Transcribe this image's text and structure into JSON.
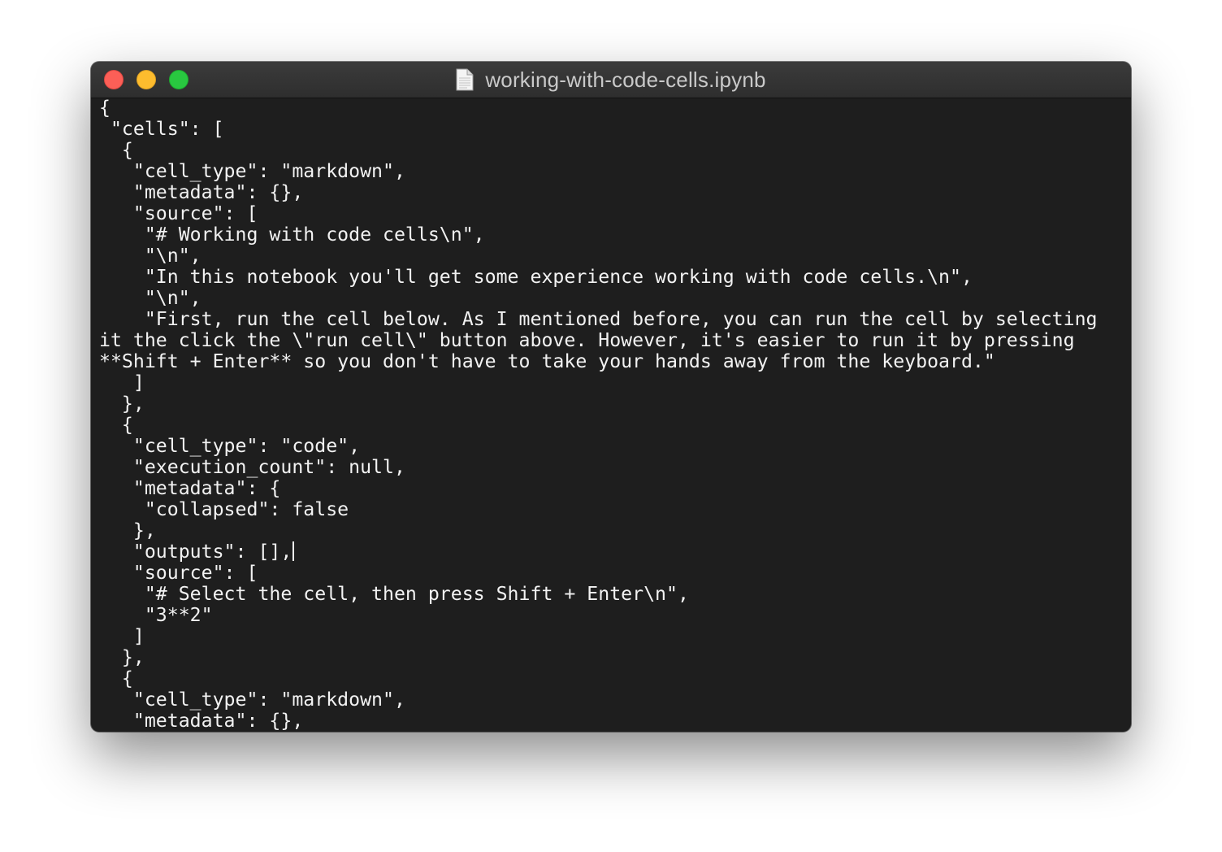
{
  "window": {
    "title": "working-with-code-cells.ipynb",
    "file_icon": "document-icon",
    "buttons": {
      "close_color": "#fc5f57",
      "minimize_color": "#fdbc2e",
      "maximize_color": "#29c840"
    }
  },
  "editor": {
    "background_color": "#1e1e1e",
    "text_color": "#f2f2f2",
    "cursor_line": 21,
    "lines": [
      "{",
      " \"cells\": [",
      "  {",
      "   \"cell_type\": \"markdown\",",
      "   \"metadata\": {},",
      "   \"source\": [",
      "    \"# Working with code cells\\n\",",
      "    \"\\n\",",
      "    \"In this notebook you'll get some experience working with code cells.\\n\",",
      "    \"\\n\",",
      "    \"First, run the cell below. As I mentioned before, you can run the cell by selecting",
      "it the click the \\\"run cell\\\" button above. However, it's easier to run it by pressing",
      "**Shift + Enter** so you don't have to take your hands away from the keyboard.\"",
      "   ]",
      "  },",
      "  {",
      "   \"cell_type\": \"code\",",
      "   \"execution_count\": null,",
      "   \"metadata\": {",
      "    \"collapsed\": false",
      "   },",
      "   \"outputs\": [],",
      "   \"source\": [",
      "    \"# Select the cell, then press Shift + Enter\\n\",",
      "    \"3**2\"",
      "   ]",
      "  },",
      "  {",
      "   \"cell_type\": \"markdown\",",
      "   \"metadata\": {},"
    ]
  }
}
